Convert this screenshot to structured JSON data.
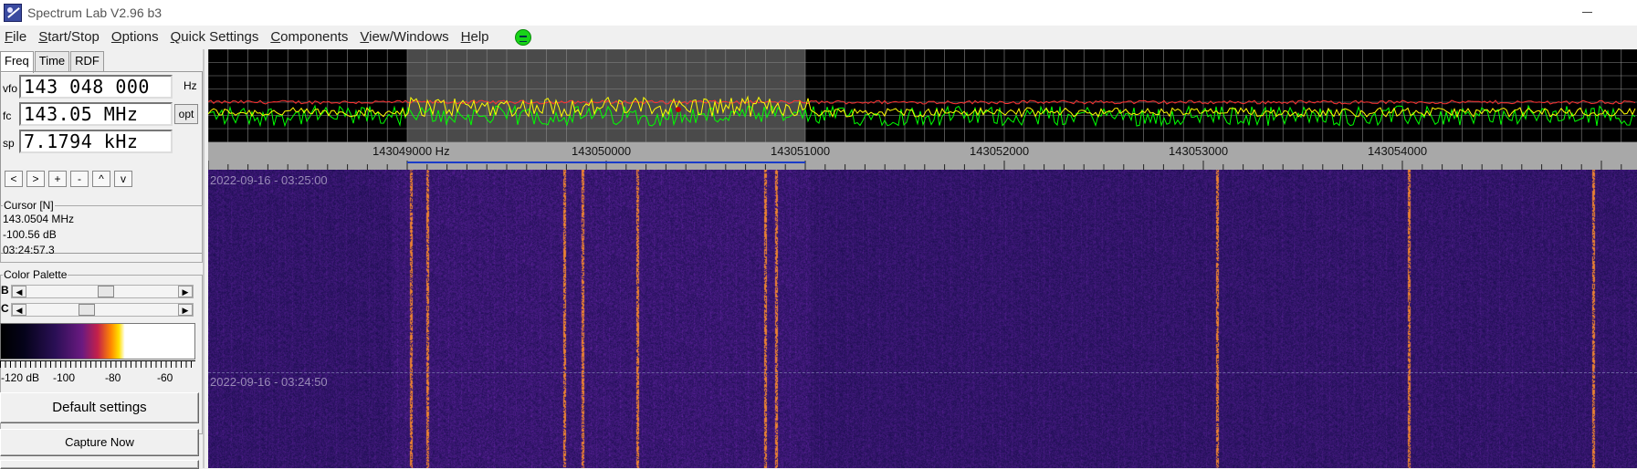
{
  "window": {
    "title": "Spectrum Lab V2.96 b3"
  },
  "menu": [
    {
      "label": "File",
      "accel": "F",
      "rest": "ile"
    },
    {
      "label": "Start/Stop",
      "accel": "S",
      "rest": "tart/Stop"
    },
    {
      "label": "Options",
      "accel": "O",
      "rest": "ptions"
    },
    {
      "label": "Quick Settings",
      "accel": "Q",
      "rest": "uick Settings"
    },
    {
      "label": "Components",
      "accel": "C",
      "rest": "omponents"
    },
    {
      "label": "View/Windows",
      "accel": "V",
      "rest": "iew/Windows"
    },
    {
      "label": "Help",
      "accel": "H",
      "rest": "elp"
    }
  ],
  "tabs": [
    "Freq",
    "Time",
    "RDF"
  ],
  "freq": {
    "vfo_label": "vfo",
    "vfo_value": "143 048 000",
    "vfo_unit": "Hz",
    "fc_label": "fc",
    "fc_value": "143.05 MHz",
    "opt_label": "opt",
    "sp_label": "sp",
    "sp_value": "7.1794 kHz"
  },
  "nav_buttons": [
    "<",
    ">",
    "+",
    "-",
    "^",
    "v"
  ],
  "cursor": {
    "title": "Cursor [N]",
    "freq": "143.0504 MHz",
    "level": "-100.56 dB",
    "time": "03:24:57.3"
  },
  "palette": {
    "title": "Color Palette",
    "b_label": "B",
    "c_label": "C",
    "b_level": 0.52,
    "c_level": 0.38,
    "scale": [
      "-120 dB",
      "-100",
      "-80",
      "-60"
    ]
  },
  "buttons": {
    "default_settings": "Default settings",
    "capture_now": "Capture Now"
  },
  "axis": {
    "labels": [
      "143049000 Hz",
      "143050000",
      "143051000",
      "143052000",
      "143053000",
      "143054000"
    ]
  },
  "waterfall": {
    "timestamps": [
      "2022-09-16 - 03:25:00",
      "2022-09-16 - 03:24:50"
    ]
  },
  "colors": {
    "spectrum_bg": "#000000",
    "trace_green": "#00ff00",
    "trace_yellow": "#ffff00",
    "trace_red": "#ff3030",
    "selection_band": "#4a4a4a",
    "waterfall_bg": "#1c1050",
    "carrier_orange": "#ff9a30"
  },
  "icons": {
    "app": "spectrum-lab-app-icon",
    "status": "running-status-led-icon"
  }
}
